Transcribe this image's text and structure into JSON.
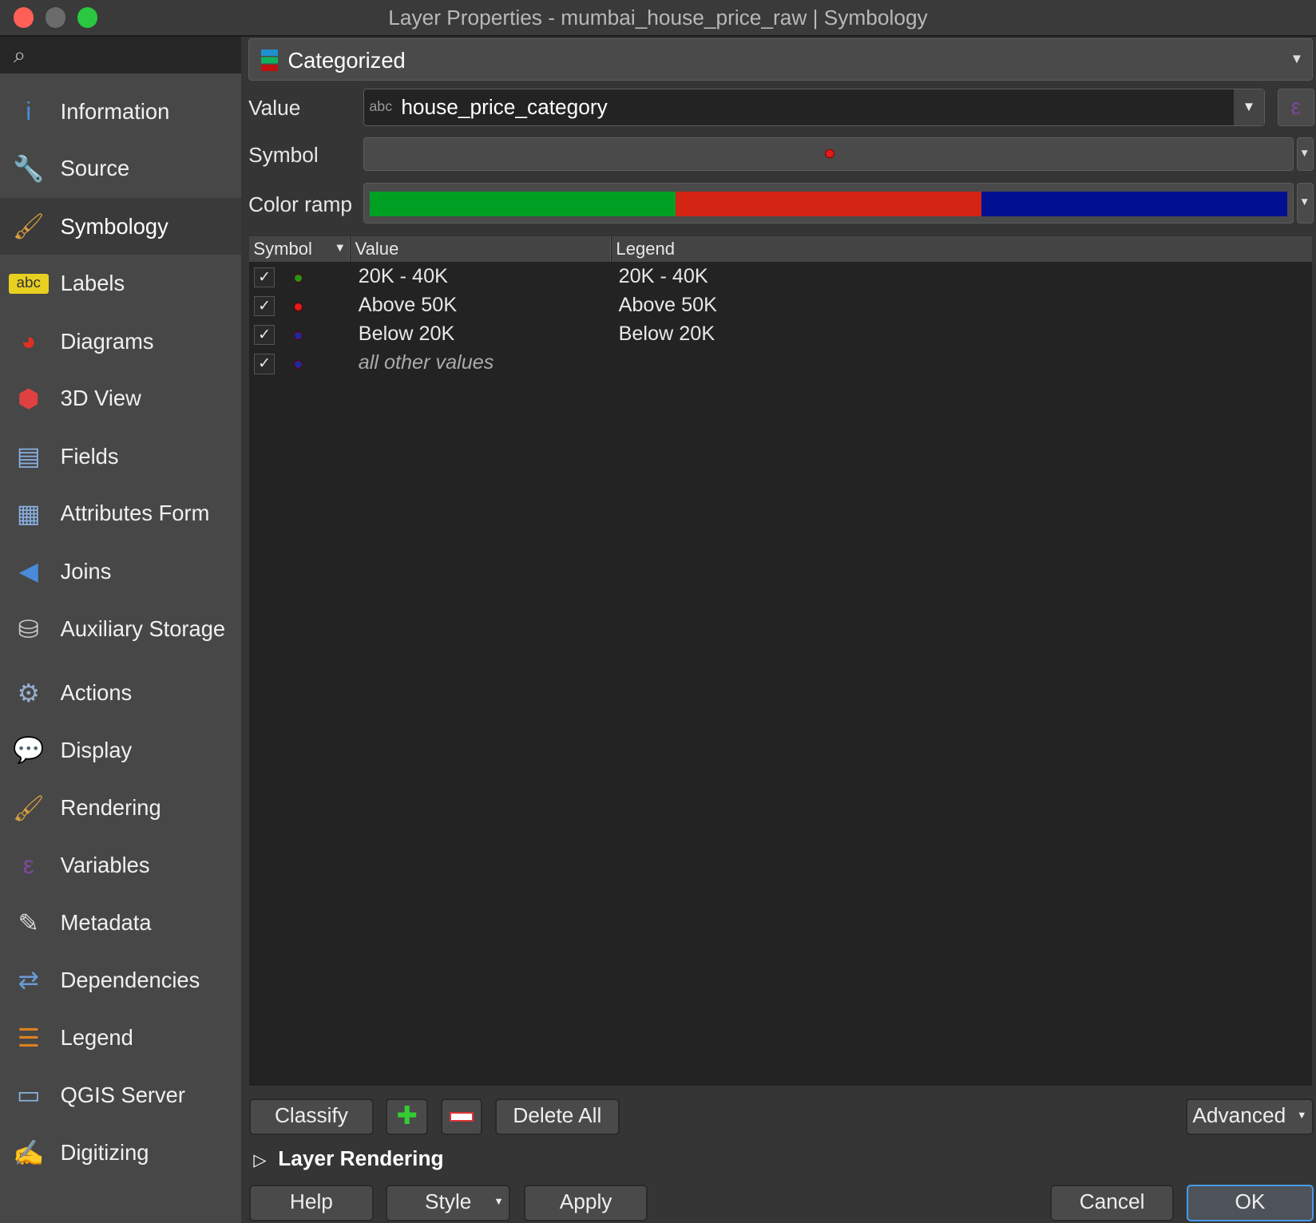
{
  "window": {
    "title": "Layer Properties - mumbai_house_price_raw | Symbology"
  },
  "sidebar": {
    "search_placeholder": "",
    "items": [
      {
        "label": "Information",
        "icon": "info-icon"
      },
      {
        "label": "Source",
        "icon": "source-icon"
      },
      {
        "label": "Symbology",
        "icon": "symbology-icon",
        "selected": true
      },
      {
        "label": "Labels",
        "icon": "labels-icon"
      },
      {
        "label": "Diagrams",
        "icon": "diagrams-icon"
      },
      {
        "label": "3D View",
        "icon": "3d-view-icon"
      },
      {
        "label": "Fields",
        "icon": "fields-icon"
      },
      {
        "label": "Attributes Form",
        "icon": "attributes-form-icon"
      },
      {
        "label": "Joins",
        "icon": "joins-icon"
      },
      {
        "label": "Auxiliary Storage",
        "icon": "auxiliary-storage-icon"
      },
      {
        "label": "Actions",
        "icon": "actions-icon"
      },
      {
        "label": "Display",
        "icon": "display-icon"
      },
      {
        "label": "Rendering",
        "icon": "rendering-icon"
      },
      {
        "label": "Variables",
        "icon": "variables-icon"
      },
      {
        "label": "Metadata",
        "icon": "metadata-icon"
      },
      {
        "label": "Dependencies",
        "icon": "dependencies-icon"
      },
      {
        "label": "Legend",
        "icon": "legend-icon"
      },
      {
        "label": "QGIS Server",
        "icon": "qgis-server-icon"
      },
      {
        "label": "Digitizing",
        "icon": "digitizing-icon"
      }
    ]
  },
  "renderer": {
    "type": "Categorized"
  },
  "value": {
    "label": "Value",
    "type_badge": "abc",
    "field": "house_price_category"
  },
  "symbol": {
    "label": "Symbol",
    "color": "#e01c1c"
  },
  "color_ramp": {
    "label": "Color ramp",
    "colors": [
      "#00a024",
      "#d42414",
      "#001090"
    ]
  },
  "table": {
    "headers": [
      "Symbol",
      "Value",
      "Legend"
    ],
    "rows": [
      {
        "checked": true,
        "color": "#1a9a1a",
        "value": "20K - 40K",
        "legend": "20K - 40K"
      },
      {
        "checked": true,
        "color": "#e01c1c",
        "value": "Above 50K",
        "legend": "Above 50K"
      },
      {
        "checked": true,
        "color": "#1a2aa0",
        "value": "Below 20K",
        "legend": "Below 20K"
      },
      {
        "checked": true,
        "color": "#1a2aa0",
        "value": "all other values",
        "legend": "",
        "other": true
      }
    ]
  },
  "buttons": {
    "classify": "Classify",
    "delete_all": "Delete All",
    "advanced": "Advanced",
    "help": "Help",
    "style": "Style",
    "apply": "Apply",
    "cancel": "Cancel",
    "ok": "OK",
    "check": "✓"
  },
  "layer_rendering": "Layer Rendering"
}
